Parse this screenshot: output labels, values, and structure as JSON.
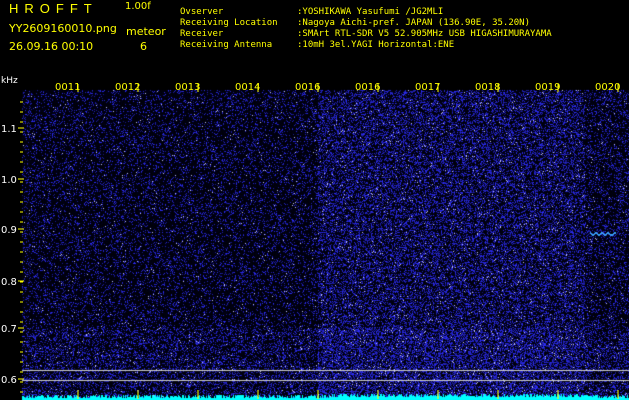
{
  "header": {
    "app_name": "HROFFT",
    "version": "1.00f",
    "file_name": "YY2609160010.png",
    "meteor_label": "meteor",
    "meteor_count": "6",
    "datetime": "26.09.16 00:10"
  },
  "station_info": [
    {
      "key": "Ovserver",
      "value": ":YOSHIKAWA Yasufumi /JG2MLI"
    },
    {
      "key": "Receiving Location",
      "value": ":Nagoya Aichi-pref. JAPAN (136.90E, 35.20N)"
    },
    {
      "key": "Receiver",
      "value": ":SMArt RTL-SDR V5 52.905MHz USB HIGASHIMURAYAMA"
    },
    {
      "key": "Receiving Antenna",
      "value": ":10mH 3el.YAGI Horizontal:ENE"
    }
  ],
  "spectrogram": {
    "y_unit": "kHz",
    "y_ticks": [
      "1.1",
      "1.0",
      "0.9",
      "0.8",
      "0.7",
      "0.6"
    ],
    "time_labels": [
      "0011",
      "0012",
      "0013",
      "0014",
      "0016",
      "0016",
      "0017",
      "0018",
      "0019",
      "0020"
    ],
    "colors": {
      "background": "#000000",
      "noise": "#2a2aff",
      "trace": "#00ffff",
      "tick": "#ffff00",
      "text": "#ffffff"
    }
  }
}
